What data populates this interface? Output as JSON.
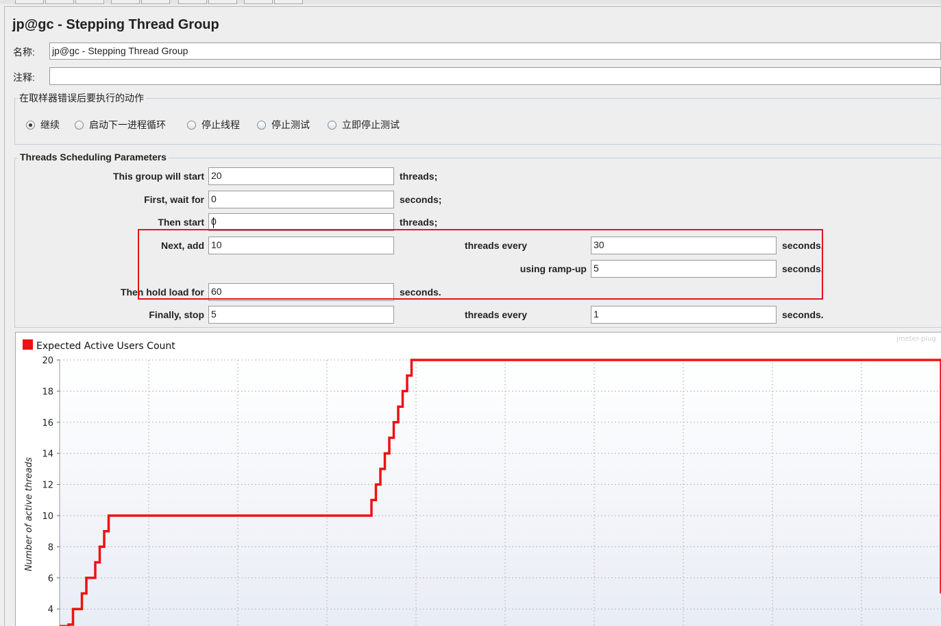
{
  "panel": {
    "title": "jp@gc - Stepping Thread Group",
    "name_label": "名称:",
    "name_value": "jp@gc - Stepping Thread Group",
    "comment_label": "注释:",
    "comment_value": ""
  },
  "sampler_error": {
    "legend": "在取样器错误后要执行的动作",
    "options": [
      {
        "label": "继续",
        "selected": true
      },
      {
        "label": "启动下一进程循环",
        "selected": false
      },
      {
        "label": "停止线程",
        "selected": false
      },
      {
        "label": "停止测试",
        "selected": false
      },
      {
        "label": "立即停止测试",
        "selected": false
      }
    ]
  },
  "params": {
    "legend": "Threads Scheduling Parameters",
    "start_label": "This group will start",
    "start_value": "20",
    "start_unit": "threads;",
    "wait_label": "First, wait for",
    "wait_value": "0",
    "wait_unit": "seconds;",
    "then_start_label": "Then start",
    "then_start_value": "0",
    "then_start_unit": "threads;",
    "next_add_label": "Next, add",
    "next_add_value": "10",
    "every_label": "threads every",
    "every_value": "30",
    "every_unit": "seconds,",
    "rampup_label": "using ramp-up",
    "rampup_value": "5",
    "rampup_unit": "seconds.",
    "hold_label": "Then hold load for",
    "hold_value": "60",
    "hold_unit": "seconds.",
    "stop_label": "Finally, stop",
    "stop_value": "5",
    "stop_every_label": "threads every",
    "stop_every_value": "1",
    "stop_every_unit": "seconds."
  },
  "chart_data": {
    "type": "line",
    "legend": "Expected Active Users Count",
    "watermark": "jmeter-plug",
    "ylabel": "Number of active threads",
    "ylim": [
      3,
      20
    ],
    "y_ticks": [
      "4",
      "6",
      "8",
      "10",
      "12",
      "14",
      "16",
      "18",
      "20"
    ],
    "color": "#ee1111",
    "series": [
      {
        "name": "Expected Active Users Count",
        "points": [
          [
            0,
            2.9
          ],
          [
            1,
            2.9
          ],
          [
            1,
            3
          ],
          [
            1.5,
            3
          ],
          [
            1.5,
            4
          ],
          [
            2.5,
            4
          ],
          [
            2.5,
            5
          ],
          [
            3,
            5
          ],
          [
            3,
            6
          ],
          [
            4,
            6
          ],
          [
            4,
            7
          ],
          [
            4.5,
            7
          ],
          [
            4.5,
            8
          ],
          [
            5,
            8
          ],
          [
            5,
            9
          ],
          [
            5.5,
            9
          ],
          [
            5.5,
            10
          ],
          [
            35,
            10
          ],
          [
            35,
            11
          ],
          [
            35.5,
            11
          ],
          [
            35.5,
            12
          ],
          [
            36,
            12
          ],
          [
            36,
            13
          ],
          [
            36.5,
            13
          ],
          [
            36.5,
            14
          ],
          [
            37,
            14
          ],
          [
            37,
            15
          ],
          [
            37.5,
            15
          ],
          [
            37.5,
            16
          ],
          [
            38,
            16
          ],
          [
            38,
            17
          ],
          [
            38.5,
            17
          ],
          [
            38.5,
            18
          ],
          [
            39,
            18
          ],
          [
            39,
            19
          ],
          [
            39.5,
            19
          ],
          [
            39.5,
            20
          ],
          [
            100,
            20
          ],
          [
            100,
            15
          ],
          [
            101,
            15
          ],
          [
            101,
            10
          ],
          [
            102,
            10
          ],
          [
            102,
            5
          ],
          [
            103,
            5
          ]
        ]
      }
    ]
  }
}
